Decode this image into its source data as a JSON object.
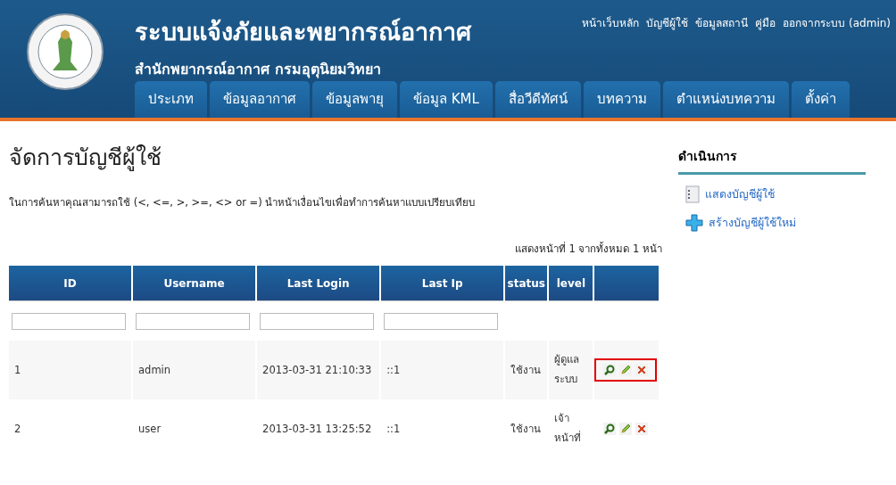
{
  "header": {
    "title": "ระบบแจ้งภัยและพยากรณ์อากาศ",
    "subtitle": "สำนักพยากรณ์อากาศ กรมอุตุนิยมวิทยา",
    "top_links": [
      "หน้าเว็บหลัก",
      "บัญชีผู้ใช้",
      "ข้อมูลสถานี",
      "คู่มือ",
      "ออกจากระบบ (admin)"
    ],
    "nav": [
      "ประเภท",
      "ข้อมูลอากาศ",
      "ข้อมูลพายุ",
      "ข้อมูล KML",
      "สื่อวีดีทัศน์",
      "บทความ",
      "ตำแหน่งบทความ",
      "ตั้งค่า"
    ]
  },
  "page": {
    "title": "จัดการบัญชีผู้ใช้",
    "hint": "ในการค้นหาคุณสามารถใช้ (<, <=, >, >=, <> or =) นำหน้าเงื่อนไขเพื่อทำการค้นหาแบบเปรียบเทียบ",
    "paging": "แสดงหน้าที่ 1 จากทั้งหมด 1 หน้า"
  },
  "table": {
    "columns": [
      "ID",
      "Username",
      "Last Login",
      "Last Ip",
      "status",
      "level"
    ],
    "rows": [
      {
        "cells": [
          "1",
          "admin",
          "2013-03-31 21:10:33",
          "::1",
          "ใช้งาน",
          "ผู้ดูแล ระบบ"
        ],
        "highlighted": true
      },
      {
        "cells": [
          "2",
          "user",
          "2013-03-31 13:25:52",
          "::1",
          "ใช้งาน",
          "เจ้า หน้าที่"
        ],
        "highlighted": false
      }
    ]
  },
  "sidebar": {
    "title": "ดำเนินการ",
    "items": [
      {
        "kind": "list",
        "label": "แสดงบัญชีผู้ใช้"
      },
      {
        "kind": "add",
        "label": "สร้างบัญชีผู้ใช้ใหม่"
      }
    ]
  }
}
